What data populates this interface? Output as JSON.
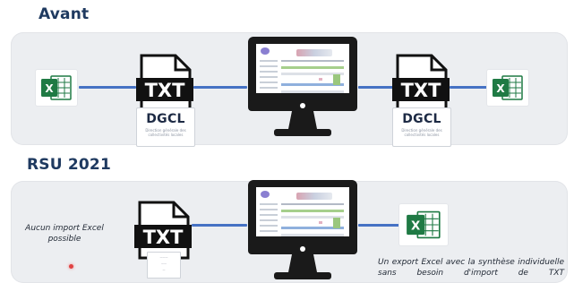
{
  "sections": {
    "before": {
      "title": "Avant",
      "dgcl_label": "DGCL",
      "dgcl_subtitle": "Direction générale des collectivités locales",
      "txt_label": "TXT"
    },
    "after": {
      "title": "RSU 2021",
      "note": "Aucun import Excel possible",
      "txt_label": "TXT",
      "export_text": "Un export Excel avec la synthèse individuelle sans besoin d'import de TXT"
    }
  },
  "icons": {
    "excel": "excel-file-icon",
    "txt": "txt-file-icon",
    "monitor": "monitor-icon"
  },
  "colors": {
    "title": "#1f3a60",
    "band": "#eceef1",
    "connector": "#4672c4",
    "excel_green": "#1f7a44",
    "txt_black": "#111111"
  }
}
